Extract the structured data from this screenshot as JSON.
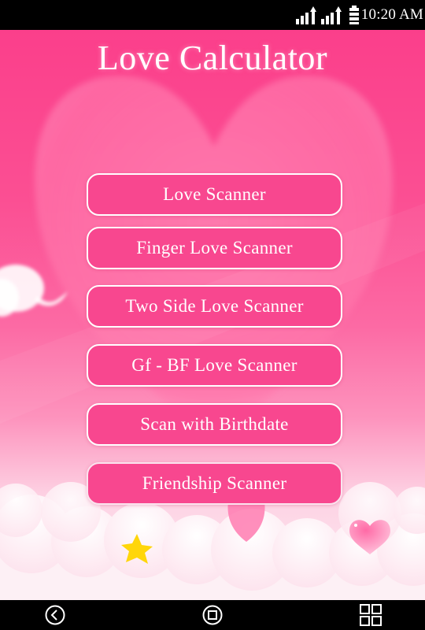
{
  "status_bar": {
    "icons": [
      "signal-icon",
      "signal-icon",
      "battery-icon"
    ],
    "time": "10:20 AM"
  },
  "app": {
    "title": "Love Calculator",
    "background_decorations": [
      "large-heart",
      "cloud",
      "star",
      "small-heart"
    ],
    "menu": [
      {
        "label": "Love Scanner"
      },
      {
        "label": "Finger Love Scanner"
      },
      {
        "label": "Two Side Love Scanner"
      },
      {
        "label": "Gf - BF Love Scanner"
      },
      {
        "label": "Scan with Birthdate"
      },
      {
        "label": "Friendship Scanner"
      }
    ],
    "colors": {
      "accent": "#f8478f",
      "button_border": "#ffffff",
      "text": "#ffffff"
    }
  },
  "nav_bar": {
    "buttons": [
      "back",
      "home",
      "recent-apps"
    ]
  }
}
